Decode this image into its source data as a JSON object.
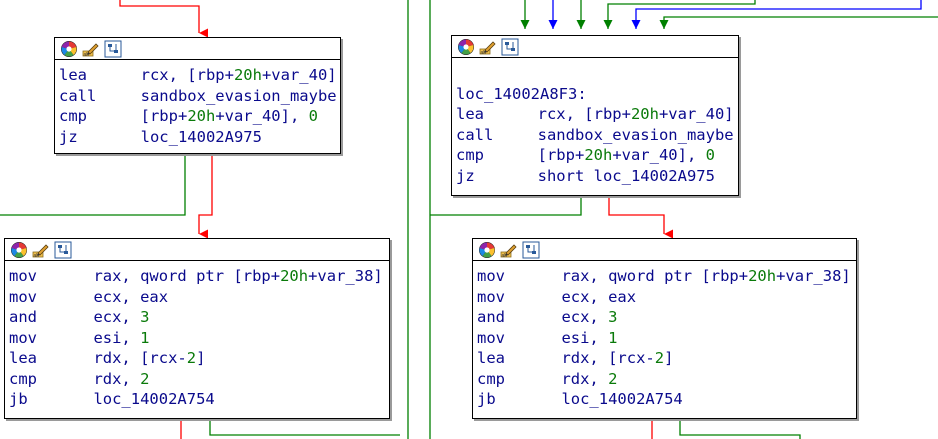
{
  "colors": {
    "branch_taken": "#ff0000",
    "branch_not_taken": "#008000",
    "unconditional": "#0000ff",
    "node_border": "#000000"
  },
  "header_icons": [
    "color-wheel-icon",
    "rename-pencil-icon",
    "graph-overview-icon"
  ],
  "nodes": [
    {
      "id": "node-1",
      "label": "",
      "lines": [
        {
          "mn": "lea",
          "op": [
            {
              "t": "rcx, [rbp+",
              "c": "op"
            },
            {
              "t": "20h",
              "c": "num"
            },
            {
              "t": "+var_40]",
              "c": "op"
            }
          ]
        },
        {
          "mn": "call",
          "op": [
            {
              "t": "sandbox_evasion_maybe",
              "c": "sym"
            }
          ]
        },
        {
          "mn": "cmp",
          "op": [
            {
              "t": "[rbp+",
              "c": "op"
            },
            {
              "t": "20h",
              "c": "num"
            },
            {
              "t": "+var_40], ",
              "c": "op"
            },
            {
              "t": "0",
              "c": "num"
            }
          ]
        },
        {
          "mn": "jz",
          "op": [
            {
              "t": "loc_14002A975",
              "c": "sym"
            }
          ]
        }
      ]
    },
    {
      "id": "node-2",
      "label": "loc_14002A8F3:",
      "lines": [
        {
          "mn": "lea",
          "op": [
            {
              "t": "rcx, [rbp+",
              "c": "op"
            },
            {
              "t": "20h",
              "c": "num"
            },
            {
              "t": "+var_40]",
              "c": "op"
            }
          ]
        },
        {
          "mn": "call",
          "op": [
            {
              "t": "sandbox_evasion_maybe",
              "c": "sym"
            }
          ]
        },
        {
          "mn": "cmp",
          "op": [
            {
              "t": "[rbp+",
              "c": "op"
            },
            {
              "t": "20h",
              "c": "num"
            },
            {
              "t": "+var_40], ",
              "c": "op"
            },
            {
              "t": "0",
              "c": "num"
            }
          ]
        },
        {
          "mn": "jz",
          "op": [
            {
              "t": "short loc_14002A975",
              "c": "sym"
            }
          ]
        }
      ]
    },
    {
      "id": "node-3",
      "label": "",
      "lines": [
        {
          "mn": "mov",
          "op": [
            {
              "t": "rax, qword ptr [rbp+",
              "c": "op"
            },
            {
              "t": "20h",
              "c": "num"
            },
            {
              "t": "+var_38]",
              "c": "op"
            }
          ]
        },
        {
          "mn": "mov",
          "op": [
            {
              "t": "ecx, eax",
              "c": "op"
            }
          ]
        },
        {
          "mn": "and",
          "op": [
            {
              "t": "ecx, ",
              "c": "op"
            },
            {
              "t": "3",
              "c": "num"
            }
          ]
        },
        {
          "mn": "mov",
          "op": [
            {
              "t": "esi, ",
              "c": "op"
            },
            {
              "t": "1",
              "c": "num"
            }
          ]
        },
        {
          "mn": "lea",
          "op": [
            {
              "t": "rdx, [rcx-",
              "c": "op"
            },
            {
              "t": "2",
              "c": "num"
            },
            {
              "t": "]",
              "c": "op"
            }
          ]
        },
        {
          "mn": "cmp",
          "op": [
            {
              "t": "rdx, ",
              "c": "op"
            },
            {
              "t": "2",
              "c": "num"
            }
          ]
        },
        {
          "mn": "jb",
          "op": [
            {
              "t": "loc_14002A754",
              "c": "sym"
            }
          ]
        }
      ]
    },
    {
      "id": "node-4",
      "label": "",
      "lines": [
        {
          "mn": "mov",
          "op": [
            {
              "t": "rax, qword ptr [rbp+",
              "c": "op"
            },
            {
              "t": "20h",
              "c": "num"
            },
            {
              "t": "+var_38]",
              "c": "op"
            }
          ]
        },
        {
          "mn": "mov",
          "op": [
            {
              "t": "ecx, eax",
              "c": "op"
            }
          ]
        },
        {
          "mn": "and",
          "op": [
            {
              "t": "ecx, ",
              "c": "op"
            },
            {
              "t": "3",
              "c": "num"
            }
          ]
        },
        {
          "mn": "mov",
          "op": [
            {
              "t": "esi, ",
              "c": "op"
            },
            {
              "t": "1",
              "c": "num"
            }
          ]
        },
        {
          "mn": "lea",
          "op": [
            {
              "t": "rdx, [rcx-",
              "c": "op"
            },
            {
              "t": "2",
              "c": "num"
            },
            {
              "t": "]",
              "c": "op"
            }
          ]
        },
        {
          "mn": "cmp",
          "op": [
            {
              "t": "rdx, ",
              "c": "op"
            },
            {
              "t": "2",
              "c": "num"
            }
          ]
        },
        {
          "mn": "jb",
          "op": [
            {
              "t": "loc_14002A754",
              "c": "sym"
            }
          ]
        }
      ]
    }
  ]
}
